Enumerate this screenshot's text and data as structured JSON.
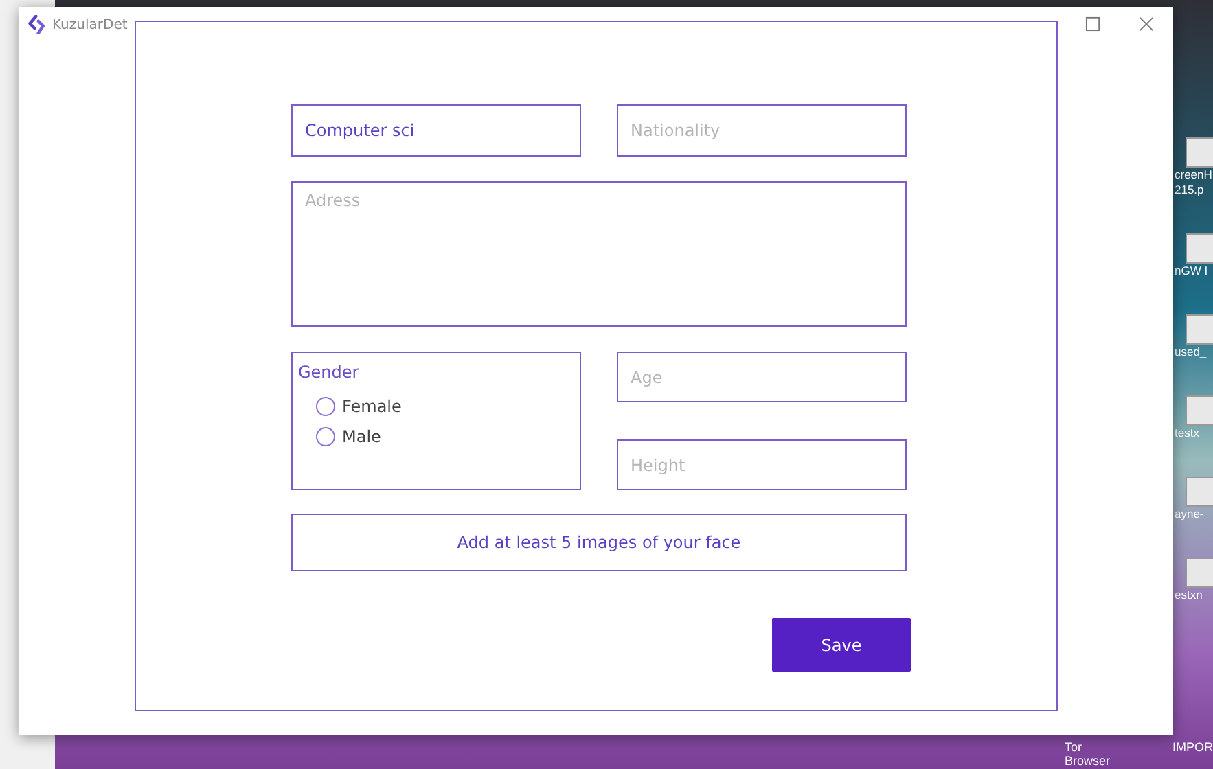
{
  "window": {
    "title": "KuzularDet"
  },
  "form": {
    "study": {
      "value": "Computer sci"
    },
    "nationality": {
      "placeholder": "Nationality"
    },
    "address": {
      "placeholder": "Adress"
    },
    "gender": {
      "label": "Gender",
      "options": [
        {
          "label": "Female",
          "selected": false
        },
        {
          "label": "Male",
          "selected": false
        }
      ]
    },
    "age": {
      "placeholder": "Age"
    },
    "height": {
      "placeholder": "Height"
    },
    "images_button": "Add at least 5 images of your face",
    "save_button": "Save"
  },
  "desktop": {
    "side_icons": [
      {
        "lines": [
          "creenH",
          "215.p"
        ]
      },
      {
        "lines": [
          "nGW I"
        ]
      },
      {
        "lines": [
          "used_"
        ]
      },
      {
        "lines": [
          "testx"
        ]
      },
      {
        "lines": [
          "ayne-"
        ]
      },
      {
        "lines": [
          "estxn"
        ]
      }
    ],
    "bottom_icons": [
      "Tor Browser",
      "IMPOR"
    ]
  }
}
